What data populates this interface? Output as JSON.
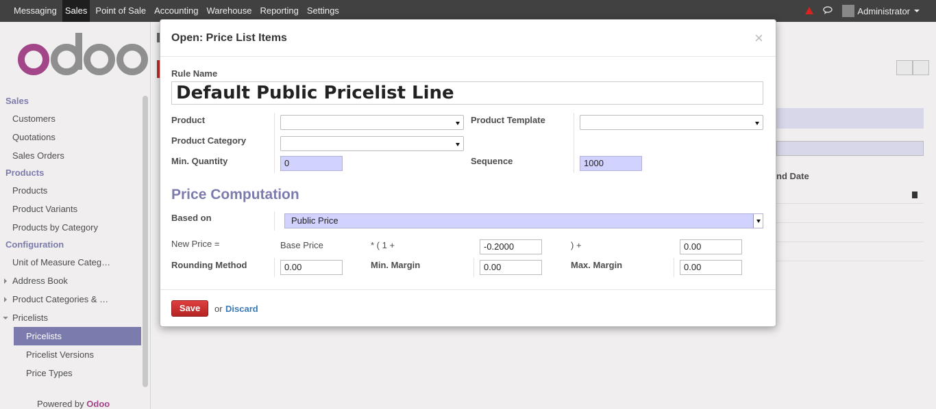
{
  "topbar": {
    "menu": [
      "Messaging",
      "Sales",
      "Point of Sale",
      "Accounting",
      "Warehouse",
      "Reporting",
      "Settings"
    ],
    "active": "Sales",
    "user": "Administrator"
  },
  "sidebar": {
    "sections": [
      {
        "header": "Sales",
        "items": [
          "Customers",
          "Quotations",
          "Sales Orders"
        ]
      },
      {
        "header": "Products",
        "items": [
          "Products",
          "Product Variants",
          "Products by Category"
        ]
      },
      {
        "header": "Configuration",
        "items": [
          "Unit of Measure Categ…",
          "Address Book",
          "Product Categories & …",
          "Pricelists"
        ]
      }
    ],
    "pricelist_subitems": [
      "Pricelists",
      "Pricelist Versions",
      "Price Types"
    ],
    "powered_prefix": "Powered by",
    "powered_brand": "Odoo"
  },
  "background": {
    "column_header": "nd Date"
  },
  "modal": {
    "title": "Open: Price List Items",
    "close": "×",
    "rule_name_label": "Rule Name",
    "rule_name_value": "Default Public Pricelist Line",
    "product_label": "Product",
    "product_value": "",
    "product_template_label": "Product Template",
    "product_template_value": "",
    "product_category_label": "Product Category",
    "product_category_value": "",
    "min_quantity_label": "Min. Quantity",
    "min_quantity_value": "0",
    "sequence_label": "Sequence",
    "sequence_value": "1000",
    "section_title": "Price Computation",
    "based_on_label": "Based on",
    "based_on_value": "Public Price",
    "new_price_label": "New Price =",
    "base_price_text": "Base Price",
    "times_text": "* ( 1 +",
    "discount_value": "-0.2000",
    "plus_text": ") +",
    "surcharge_value": "0.00",
    "rounding_label": "Rounding Method",
    "rounding_value": "0.00",
    "min_margin_label": "Min. Margin",
    "min_margin_value": "0.00",
    "max_margin_label": "Max. Margin",
    "max_margin_value": "0.00",
    "save_label": "Save",
    "or_text": "or",
    "discard_label": "Discard"
  }
}
